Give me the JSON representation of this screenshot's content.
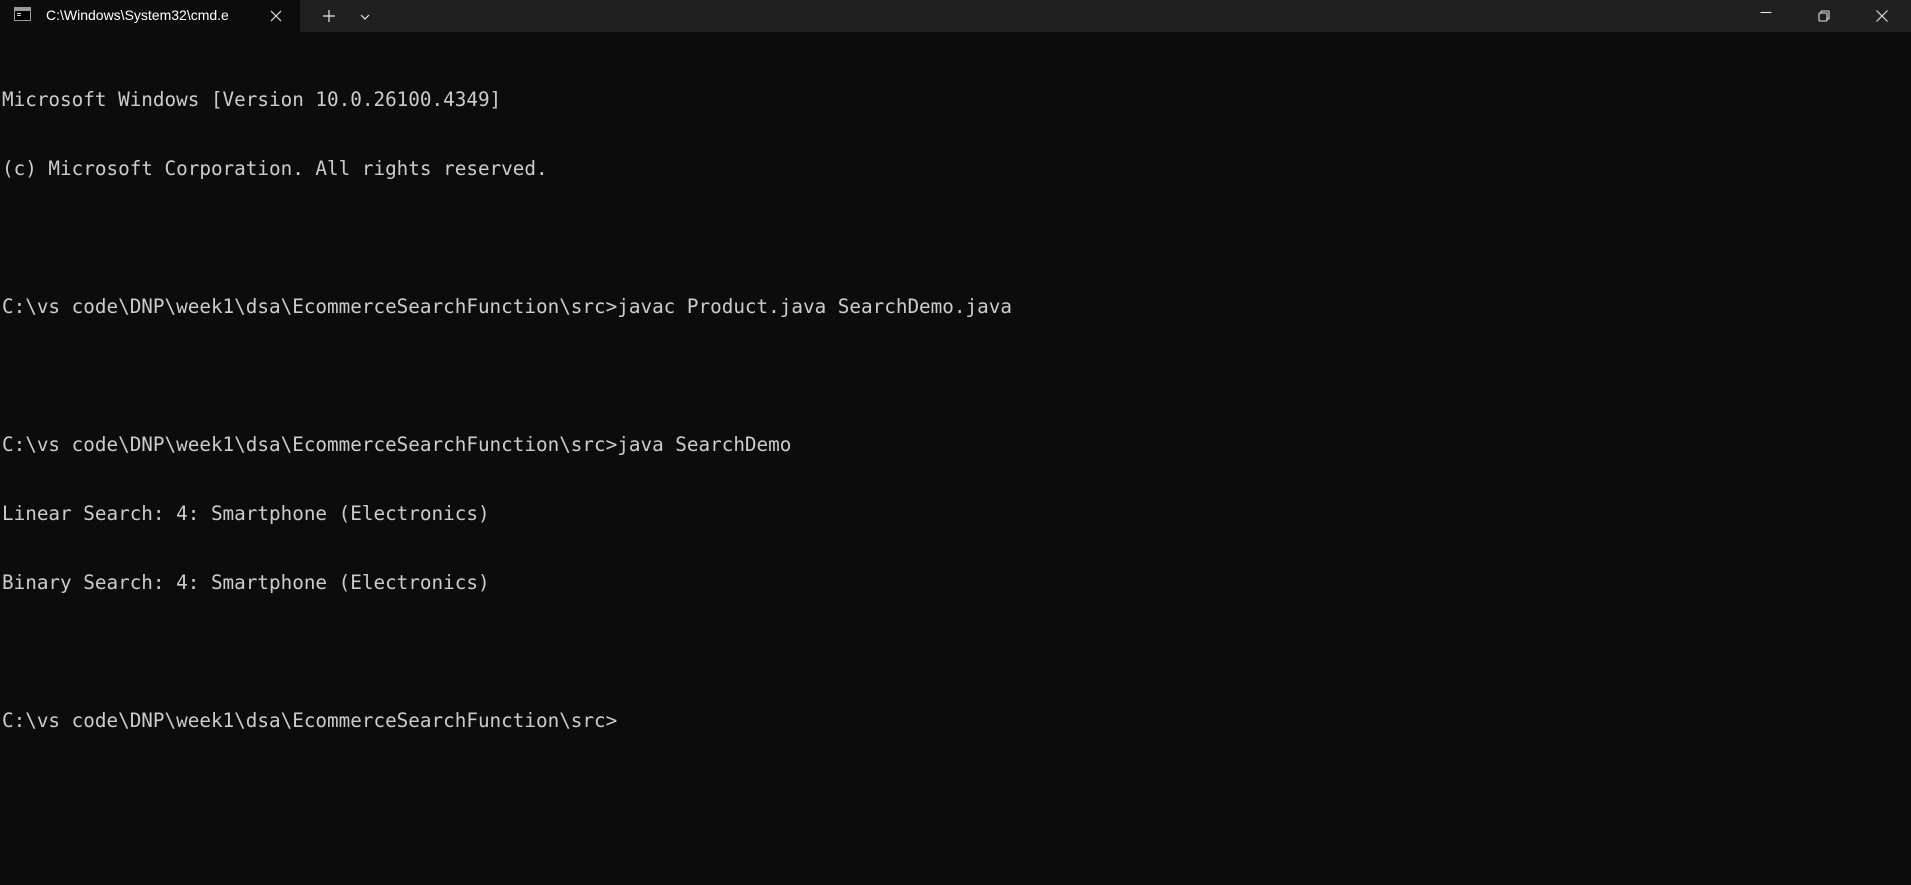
{
  "window": {
    "tab_title": "C:\\Windows\\System32\\cmd.e",
    "tab_icon": "command-prompt-icon",
    "close_tab_glyph": "✕",
    "new_tab_glyph": "+",
    "dropdown_glyph": "⌄"
  },
  "console": {
    "lines": [
      "Microsoft Windows [Version 10.0.26100.4349]",
      "(c) Microsoft Corporation. All rights reserved.",
      "",
      "C:\\vs code\\DNP\\week1\\dsa\\EcommerceSearchFunction\\src>javac Product.java SearchDemo.java",
      "",
      "C:\\vs code\\DNP\\week1\\dsa\\EcommerceSearchFunction\\src>java SearchDemo",
      "Linear Search: 4: Smartphone (Electronics)",
      "Binary Search: 4: Smartphone (Electronics)",
      "",
      "C:\\vs code\\DNP\\week1\\dsa\\EcommerceSearchFunction\\src>"
    ]
  },
  "colors": {
    "background": "#0c0c0c",
    "titlebar": "#202020",
    "text": "#cccccc"
  }
}
